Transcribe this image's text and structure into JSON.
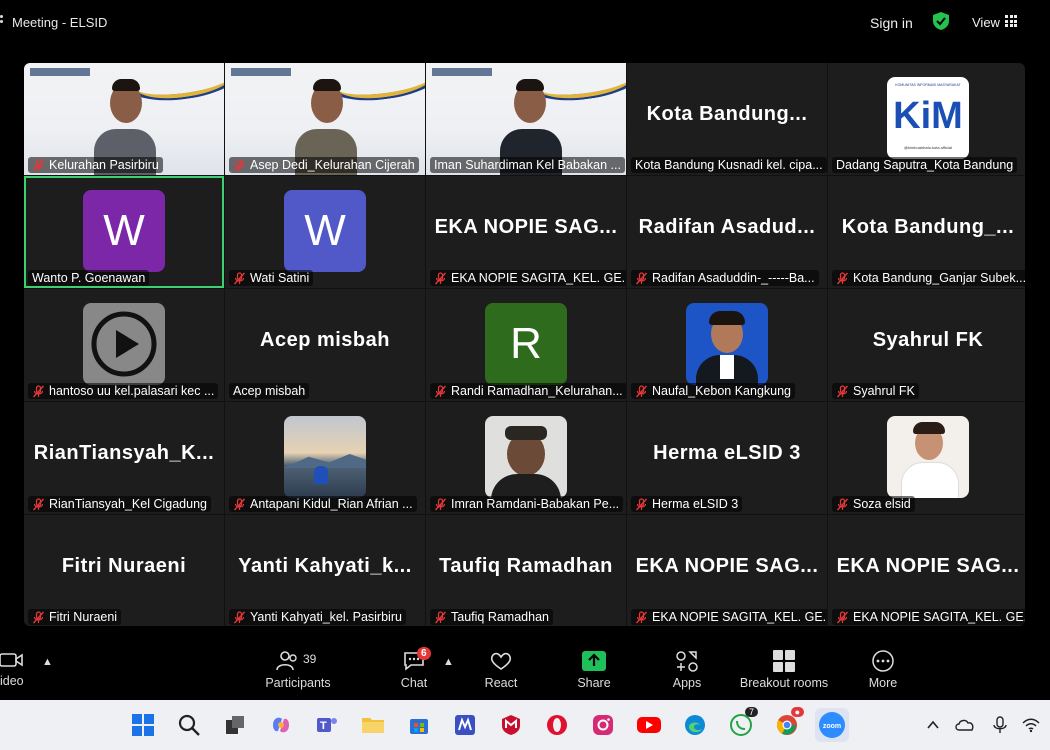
{
  "window": {
    "title": "Meeting - ELSID",
    "sign_in": "Sign in",
    "view": "View"
  },
  "tiles": [
    {
      "type": "video",
      "label": "Kelurahan Pasirbiru",
      "muted": true,
      "video_text": "ER TRAINING\nATAN II"
    },
    {
      "type": "video",
      "label": "Asep Dedi_Kelurahan Cijerah",
      "muted": true,
      "video_text": ""
    },
    {
      "type": "video",
      "label": "Iman Suhardiman Kel Babakan ...",
      "muted": false,
      "video_text": ""
    },
    {
      "type": "name",
      "big": "Kota  Bandung...",
      "label": "Kota Bandung Kusnadi kel. cipa...",
      "muted": false
    },
    {
      "type": "logo",
      "logo_text": "KiM",
      "logo_caption": "KOMUNITAS INFORMASI MASYARAKAT",
      "logo_handle": "@kimbuahbatu.kota.official",
      "label": "Dadang Saputra_Kota Bandung",
      "muted": false
    },
    {
      "type": "avatar",
      "letter": "W",
      "color": "#7c27a8",
      "label": "Wanto P. Goenawan",
      "muted": false,
      "active": true
    },
    {
      "type": "avatar",
      "letter": "W",
      "color": "#5158c8",
      "label": "Wati Satini",
      "muted": true
    },
    {
      "type": "name",
      "big": "EKA  NOPIE  SAG...",
      "label": "EKA NOPIE SAGITA_KEL. GE...",
      "muted": true
    },
    {
      "type": "name",
      "big": "Radifan  Asadud...",
      "label": "Radifan Asaduddin-_-----Ba...",
      "muted": true
    },
    {
      "type": "name",
      "big": "Kota  Bandung_...",
      "label": "Kota Bandung_Ganjar Subek...",
      "muted": true
    },
    {
      "type": "play",
      "label": "hantoso uu kel.palasari kec ...",
      "muted": true
    },
    {
      "type": "name",
      "big": "Acep misbah",
      "label": "Acep misbah",
      "muted": false
    },
    {
      "type": "avatar",
      "letter": "R",
      "color": "#2f6b1d",
      "label": "Randi Ramadhan_Kelurahan...",
      "muted": true
    },
    {
      "type": "photo-blue",
      "label": "Naufal_Kebon Kangkung",
      "muted": true
    },
    {
      "type": "name",
      "big": "Syahrul FK",
      "label": "Syahrul FK",
      "muted": true
    },
    {
      "type": "name",
      "big": "RianTiansyah_K...",
      "label": "RianTiansyah_Kel Cigadung",
      "muted": true
    },
    {
      "type": "photo-mountain",
      "label": "Antapani Kidul_Rian Afrian ...",
      "muted": true
    },
    {
      "type": "photo-man",
      "label": "Imran Ramdani-Babakan Pe...",
      "muted": true
    },
    {
      "type": "name",
      "big": "Herma eLSID 3",
      "label": "Herma eLSID 3",
      "muted": true
    },
    {
      "type": "photo-light",
      "label": "Soza elsid",
      "muted": true
    },
    {
      "type": "name",
      "big": "Fitri Nuraeni",
      "label": "Fitri Nuraeni",
      "muted": true
    },
    {
      "type": "name",
      "big": "Yanti  Kahyati_k...",
      "label": "Yanti Kahyati_kel. Pasirbiru",
      "muted": true
    },
    {
      "type": "name",
      "big": "Taufiq Ramadhan",
      "label": "Taufiq Ramadhan",
      "muted": true
    },
    {
      "type": "name",
      "big": "EKA  NOPIE  SAG...",
      "label": "EKA NOPIE SAGITA_KEL. GE...",
      "muted": true
    },
    {
      "type": "name",
      "big": "EKA  NOPIE  SAG...",
      "label": "EKA NOPIE SAGITA_KEL. GE...",
      "muted": true
    }
  ],
  "toolbar": {
    "video_label": "ideo",
    "participants_count": "39",
    "participants_label": "Participants",
    "chat_label": "Chat",
    "chat_badge": "6",
    "react_label": "React",
    "share_label": "Share",
    "apps_label": "Apps",
    "breakout_label": "Breakout rooms",
    "more_label": "More"
  },
  "taskbar": {
    "whatsapp_badge": "7",
    "zoom_label": "zoom"
  },
  "colors": {
    "active_border": "#3ecf6e",
    "share_green": "#1fbf5a",
    "mute_red": "#e3383a"
  }
}
